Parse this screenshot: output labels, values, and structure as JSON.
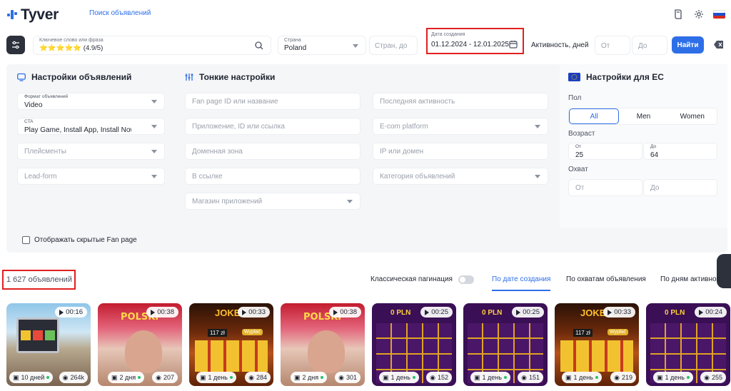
{
  "app": {
    "logo": "Tyver",
    "nav_link": "Поиск объявлений"
  },
  "colors": {
    "accent": "#2e6fe8",
    "highlight": "#e0201f",
    "dark": "#2c313c"
  },
  "filters": {
    "keyword": {
      "label": "Ключевое слово или фраза",
      "value": "⭐⭐⭐⭐⭐ (4.9/5)"
    },
    "country": {
      "label": "Страна",
      "value": "Poland"
    },
    "country_to": {
      "placeholder": "Стран, до"
    },
    "created": {
      "label": "Дата создания",
      "value": "01.12.2024 - 12.01.2025"
    },
    "activity": {
      "label": "Активность, дней",
      "from": "От",
      "to": "До"
    },
    "search_btn": "Найти"
  },
  "ad_settings": {
    "title": "Настройки объявлений",
    "format": {
      "label": "Формат объявлений",
      "value": "Video"
    },
    "cta": {
      "label": "CTA",
      "value": "Play Game, Install App, Install Now"
    },
    "placements": "Плейсменты",
    "lead_form": "Lead-form"
  },
  "fine_settings": {
    "title": "Тонкие настройки",
    "fanpage": "Fan page ID или название",
    "app": "Приложение, ID или ссылка",
    "domain": "Доменная зона",
    "in_link": "В ссылке",
    "stores": "Магазин приложений",
    "last_activity": "Последняя активность",
    "ecom": "E-com platform",
    "ip": "IP или домен",
    "category": "Категория объявлений"
  },
  "eu_settings": {
    "title": "Настройки для ЕС",
    "gender_label": "Пол",
    "genders": [
      "All",
      "Men",
      "Women"
    ],
    "age_label": "Возраст",
    "age_from_label": "От",
    "age_from": "25",
    "age_to_label": "До",
    "age_to": "64",
    "reach_label": "Охват",
    "reach_from": "От",
    "reach_to": "До"
  },
  "hidden_fanpage": "Отображать скрытые Fan page",
  "results": {
    "count": "1 627 объявлений",
    "pagination": "Классическая пагинация",
    "sort": [
      "По дате создания",
      "По охватам объявления",
      "По дням активнос"
    ]
  },
  "cards": [
    {
      "duration": "00:16",
      "days": "10 дней",
      "views": "264k"
    },
    {
      "duration": "00:38",
      "days": "2 дня",
      "views": "207"
    },
    {
      "duration": "00:33",
      "days": "1 день",
      "views": "284"
    },
    {
      "duration": "00:38",
      "days": "2 дня",
      "views": "301"
    },
    {
      "duration": "00:25",
      "days": "1 день",
      "views": "152"
    },
    {
      "duration": "00:25",
      "days": "1 день",
      "views": "151"
    },
    {
      "duration": "00:33",
      "days": "1 день",
      "views": "219"
    },
    {
      "duration": "00:24",
      "days": "1 день",
      "views": "255"
    }
  ],
  "card_texts": {
    "zloty": "0 PLN",
    "polski": "POLSKI",
    "joker": "JOKER",
    "wyplac": "Wypłać",
    "balance": "117 zł"
  }
}
